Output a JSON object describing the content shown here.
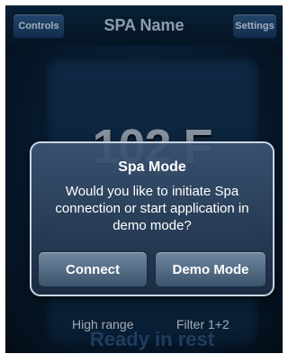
{
  "header": {
    "title": "SPA Name",
    "left_button": "Controls",
    "right_button": "Settings"
  },
  "panel": {
    "temperature": "102 F",
    "status": "Ready in rest",
    "range": "High range",
    "filter": "Filter 1+2"
  },
  "dialog": {
    "title": "Spa Mode",
    "message": "Would you like to initiate Spa connection or start application in demo mode?",
    "connect_label": "Connect",
    "demo_label": "Demo Mode"
  }
}
